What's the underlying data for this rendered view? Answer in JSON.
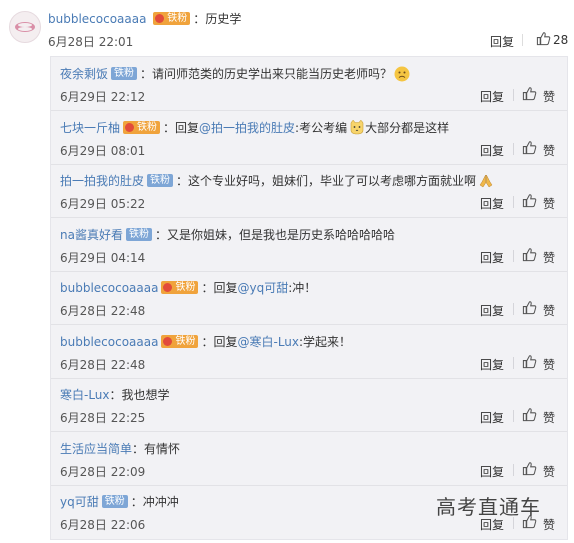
{
  "top_comment": {
    "user": "bubblecocoaaaa",
    "badge": "铁粉",
    "separator": "：",
    "text": "历史学",
    "time": "6月28日 22:01",
    "reply_label": "回复",
    "like_count": "28"
  },
  "replies": [
    {
      "user": "夜余剩饭",
      "badge": "铁粉",
      "badge_type": "blue",
      "prefix": "",
      "mention": "",
      "text": "：请问师范类的历史学出来只能当历史老师吗？",
      "emoji": "sad-face",
      "time": "6月29日 22:12"
    },
    {
      "user": "七块一斤柚",
      "badge": "铁粉",
      "badge_type": "orange",
      "prefix": "：回复",
      "mention": "@拍一拍我的肚皮",
      "text": ":考公考编",
      "emoji": "cat-face",
      "suffix": "大部分都是这样",
      "time": "6月29日 08:01"
    },
    {
      "user": "拍一拍我的肚皮",
      "badge": "铁粉",
      "badge_type": "blue",
      "prefix": "",
      "mention": "",
      "text": "：这个专业好吗，姐妹们，毕业了可以考虑哪方面就业啊",
      "emoji": "pray",
      "time": "6月29日 05:22"
    },
    {
      "user": "na酱真好看",
      "badge": "铁粉",
      "badge_type": "blue",
      "prefix": "",
      "mention": "",
      "text": "：又是你姐妹，但是我也是历史系哈哈哈哈哈",
      "emoji": "",
      "time": "6月29日 04:14"
    },
    {
      "user": "bubblecocoaaaa",
      "badge": "铁粉",
      "badge_type": "orange",
      "prefix": "：回复",
      "mention": "@yq可甜",
      "text": ":冲！",
      "emoji": "",
      "time": "6月28日 22:48"
    },
    {
      "user": "bubblecocoaaaa",
      "badge": "铁粉",
      "badge_type": "orange",
      "prefix": "：回复",
      "mention": "@寒白-Lux",
      "text": ":学起来！",
      "emoji": "",
      "time": "6月28日 22:48"
    },
    {
      "user": "寒白-Lux",
      "badge": "",
      "badge_type": "",
      "prefix": "",
      "mention": "",
      "text": "：我也想学",
      "emoji": "",
      "time": "6月28日 22:25"
    },
    {
      "user": "生活应当简单",
      "badge": "",
      "badge_type": "",
      "prefix": "",
      "mention": "",
      "text": "：有情怀",
      "emoji": "",
      "time": "6月28日 22:09"
    },
    {
      "user": "yq可甜",
      "badge": "铁粉",
      "badge_type": "blue",
      "prefix": "",
      "mention": "",
      "text": "：冲冲冲",
      "emoji": "",
      "time": "6月28日 22:06"
    }
  ],
  "reply_label": "回复",
  "like_label": "赞",
  "watermark": "高考直通车",
  "colors": {
    "link": "#4a7bb5",
    "panel_bg": "#f2f2f5",
    "badge_blue": "#7ea6d6",
    "badge_orange": "#f0a33c"
  }
}
